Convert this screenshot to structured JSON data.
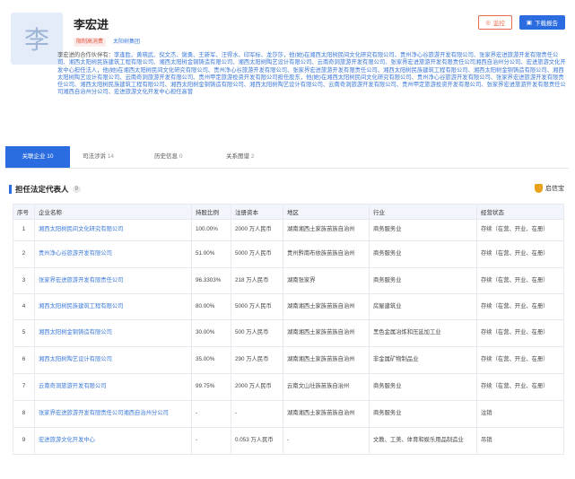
{
  "profile": {
    "avatar_char": "李",
    "name": "李宏进",
    "tags": [
      "限制高消费",
      "太阳树集团"
    ],
    "actions": {
      "monitor": "监控",
      "download": "下载报告"
    },
    "partners_label": "李宏进的合作伙伴有：",
    "partners_text": "李逢胜、黄晓武、倪文杰、谢勇、王新军、汪得水、印军标、龙莎莎，他(她)在湘西太阳树民间文化研究有限公司、贵州净心谷旅游开发有限公司、张家界宏进旅游开发有限责任公司、湘西太阳树民族建筑工程有限公司、湘西太阳树金铜铸造有限公司、湘西太阳树陶艺设计有限公司、云南奇洞旅游开发有限公司、张家界宏进旅游开发有限责任公司湘西自治州分公司、宏进旅游文化开发中心担任法人，他(她)在湘西太阳树民间文化研究有限公司、贵州净心谷旅游开发有限公司、张家界宏进旅游开发有限责任公司、湘西太阳树民族建筑工程有限公司、湘西太阳树金铜铸造有限公司、湘西太阳树陶艺设计有限公司、云南奇洞旅游开发有限公司、贵州甲定旅游投资开发有限公司担任股东，他(她)在湘西太阳树民间文化研究有限公司、贵州净心谷旅游开发有限公司、张家界宏进旅游开发有限责任公司、湘西太阳树民族建筑工程有限公司、湘西太阳树金铜铸造有限公司、湘西太阳树陶艺设计有限公司、云南奇洞旅游开发有限公司、贵州甲定旅游投资开发有限公司、张家界宏进旅游开发有限责任公司湘西自治州分公司、宏进旅游文化开发中心担任高管"
  },
  "tabs": [
    {
      "label": "关联企业",
      "count": "10"
    },
    {
      "label": "司法涉诉",
      "count": "14"
    },
    {
      "label": "历史信息",
      "count": "0"
    },
    {
      "label": "关系图谱",
      "count": "2"
    }
  ],
  "section": {
    "title": "担任法定代表人",
    "count": "9",
    "brand": "启信宝"
  },
  "table": {
    "headers": [
      "序号",
      "企业名称",
      "持股比例",
      "注册资本",
      "地区",
      "行业",
      "经营状态"
    ],
    "rows": [
      [
        "1",
        "湘西太阳树民间文化研究有限公司",
        "100.00%",
        "2000 万人民币",
        "湖南湘西土家族苗族自治州",
        "商务服务业",
        "存续（在营、开业、在册）"
      ],
      [
        "2",
        "贵州净心谷旅游开发有限公司",
        "51.00%",
        "5000 万人民币",
        "贵州黔南布依族苗族自治州",
        "商务服务业",
        "存续（在营、开业、在册）"
      ],
      [
        "3",
        "张家界宏进旅游开发有限责任公司",
        "96.3303%",
        "218 万人民币",
        "湖南张家界",
        "商务服务业",
        "存续（在营、开业、在册）"
      ],
      [
        "4",
        "湘西太阳树民族建筑工程有限公司",
        "80.00%",
        "5000 万人民币",
        "湖南湘西土家族苗族自治州",
        "房屋建筑业",
        "存续（在营、开业、在册）"
      ],
      [
        "5",
        "湘西太阳树金铜铸造有限公司",
        "30.00%",
        "500 万人民币",
        "湖南湘西土家族苗族自治州",
        "黑色金属冶炼和压延加工业",
        "存续（在营、开业、在册）"
      ],
      [
        "6",
        "湘西太阳树陶艺设计有限公司",
        "35.00%",
        "290 万人民币",
        "湖南湘西土家族苗族自治州",
        "非金属矿物制品业",
        "存续（在营、开业、在册）"
      ],
      [
        "7",
        "云南奇洞旅游开发有限公司",
        "99.75%",
        "2000 万人民币",
        "云南文山壮族苗族自治州",
        "商务服务业",
        "存续（在营、开业、在册）"
      ],
      [
        "8",
        "张家界宏进旅游开发有限责任公司湘西自治州分公司",
        "-",
        "-",
        "湖南湘西土家族苗族自治州",
        "商务服务业",
        "注销"
      ],
      [
        "9",
        "宏进旅游文化开发中心",
        "-",
        "0.053 万人民币",
        "-",
        "文教、工美、体育和娱乐用品制造业",
        "吊销"
      ]
    ]
  },
  "colors": {
    "accent": "#2b6de0",
    "link": "#3a78d8",
    "warning": "#e86a4c",
    "brand": "#e9a21a"
  }
}
